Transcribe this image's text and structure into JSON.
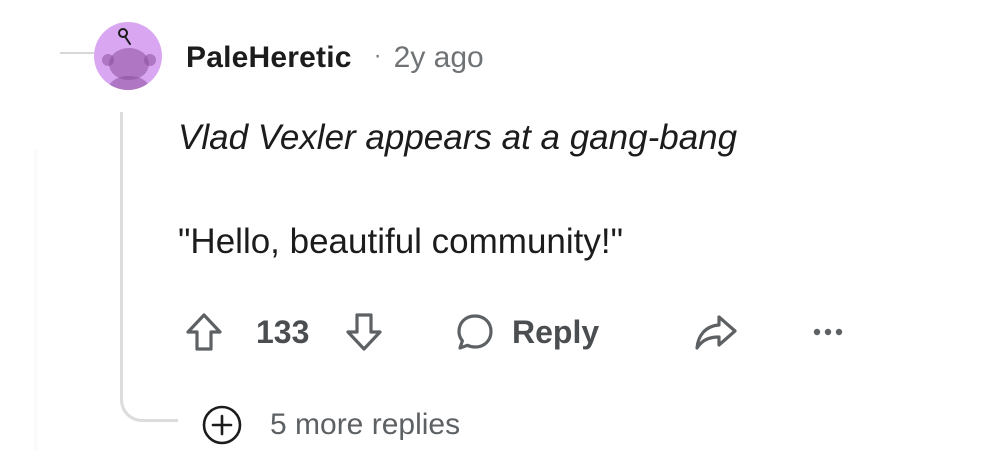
{
  "comment": {
    "author": "PaleHeretic",
    "separator": "·",
    "time_ago": "2y ago",
    "body_line_1": "Vlad Vexler appears at a gang-bang",
    "body_line_2": "\"Hello, beautiful community!\"",
    "score": "133",
    "reply_label": "Reply",
    "more_replies_label": "5 more replies"
  },
  "icons": {
    "avatar": "reddit-snoo-avatar-icon",
    "upvote": "arrow-up-icon",
    "downvote": "arrow-down-icon",
    "reply": "speech-bubble-icon",
    "share": "share-arrow-icon",
    "more": "ellipsis-icon",
    "expand": "plus-circle-icon"
  },
  "colors": {
    "avatar_bg": "#d9a7f2",
    "text_primary": "#1c1c1c",
    "text_secondary": "#6f7376",
    "icon_gray": "#5d6164",
    "thread_line": "#dcdcdc"
  }
}
